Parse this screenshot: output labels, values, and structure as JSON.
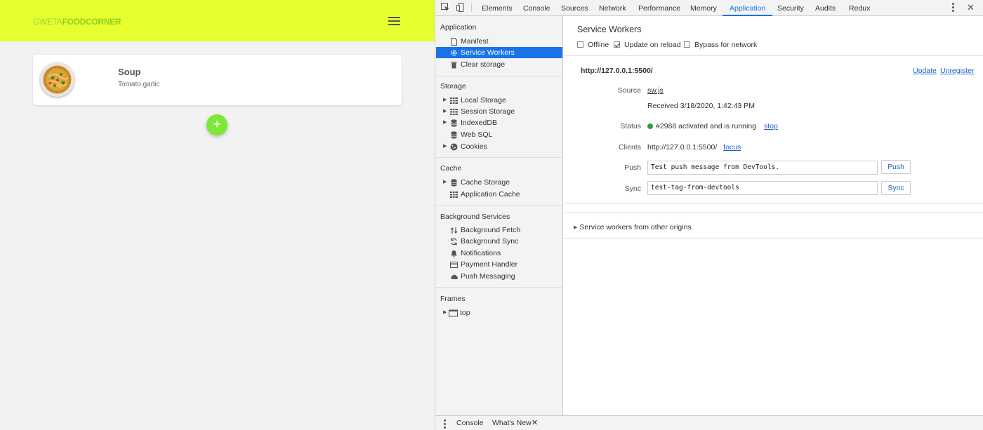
{
  "app": {
    "brand_part1": "GWETA",
    "brand_part2": "FOODCORNER",
    "header_color": "#e6ff30",
    "card": {
      "title": "Soup",
      "subtitle": "Tomato.garlic"
    },
    "fab_label": "+"
  },
  "devtools": {
    "tabs": [
      "Elements",
      "Console",
      "Sources",
      "Network",
      "Performance",
      "Memory",
      "Application",
      "Security",
      "Audits",
      "Redux"
    ],
    "active_tab": "Application",
    "accent": "#1a73e8",
    "sidebar": {
      "application": {
        "title": "Application",
        "items": [
          "Manifest",
          "Service Workers",
          "Clear storage"
        ]
      },
      "storage": {
        "title": "Storage",
        "items": [
          "Local Storage",
          "Session Storage",
          "IndexedDB",
          "Web SQL",
          "Cookies"
        ]
      },
      "cache": {
        "title": "Cache",
        "items": [
          "Cache Storage",
          "Application Cache"
        ]
      },
      "background": {
        "title": "Background Services",
        "items": [
          "Background Fetch",
          "Background Sync",
          "Notifications",
          "Payment Handler",
          "Push Messaging"
        ]
      },
      "frames": {
        "title": "Frames",
        "items": [
          "top"
        ]
      }
    },
    "service_workers": {
      "title": "Service Workers",
      "checkboxes": [
        {
          "label": "Offline",
          "checked": false
        },
        {
          "label": "Update on reload",
          "checked": true
        },
        {
          "label": "Bypass for network",
          "checked": false
        }
      ],
      "origin": "http://127.0.0.1:5500/",
      "update_link": "Update",
      "unregister_link": "Unregister",
      "source_label": "Source",
      "source_file": "sw.js",
      "received": "Received 3/18/2020, 1:42:43 PM",
      "status_label": "Status",
      "status_text": "#2988 activated and is running",
      "status_action": "stop",
      "clients_label": "Clients",
      "client_url": "http://127.0.0.1:5500/",
      "client_action": "focus",
      "push_label": "Push",
      "push_value": "Test push message from DevTools.",
      "push_button": "Push",
      "sync_label": "Sync",
      "sync_value": "test-tag-from-devtools",
      "sync_button": "Sync",
      "other_origins": "Service workers from other origins"
    },
    "drawer": {
      "tabs": [
        "Console",
        "What's New"
      ]
    }
  }
}
